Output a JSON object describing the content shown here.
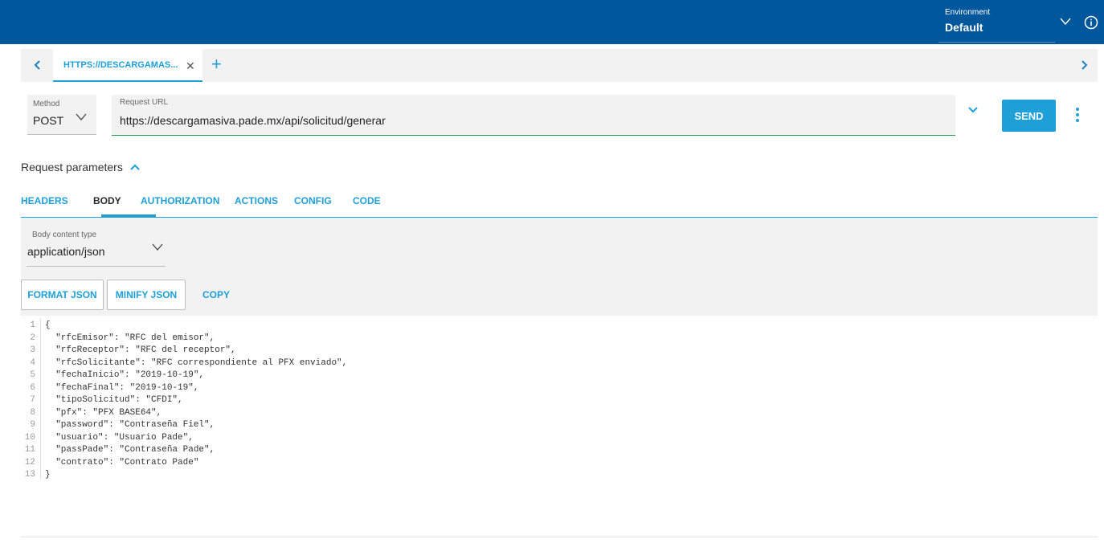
{
  "topbar": {
    "environment_label": "Environment",
    "environment_value": "Default"
  },
  "tabbar": {
    "active_tab_label": "HTTPS://DESCARGAMAS...",
    "close_glyph": "✕",
    "add_glyph": "+"
  },
  "request": {
    "method_label": "Method",
    "method_value": "POST",
    "url_label": "Request URL",
    "url_value": "https://descargamasiva.pade.mx/api/solicitud/generar",
    "send_label": "SEND"
  },
  "params": {
    "title": "Request parameters",
    "tabs": [
      "HEADERS",
      "BODY",
      "AUTHORIZATION",
      "ACTIONS",
      "CONFIG",
      "CODE"
    ],
    "active_tab": "BODY"
  },
  "body": {
    "content_type_label": "Body content type",
    "content_type_value": "application/json",
    "format_label": "FORMAT JSON",
    "minify_label": "MINIFY JSON",
    "copy_label": "COPY"
  },
  "editor": {
    "lines": [
      {
        "n": "1",
        "text": "{"
      },
      {
        "n": "2",
        "text": "  \"rfcEmisor\": \"RFC del emisor\","
      },
      {
        "n": "3",
        "text": "  \"rfcReceptor\": \"RFC del receptor\","
      },
      {
        "n": "4",
        "text": "  \"rfcSolicitante\": \"RFC correspondiente al PFX enviado\","
      },
      {
        "n": "5",
        "text": "  \"fechaInicio\": \"2019-10-19\","
      },
      {
        "n": "6",
        "text": "  \"fechaFinal\": \"2019-10-19\","
      },
      {
        "n": "7",
        "text": "  \"tipoSolicitud\": \"CFDI\","
      },
      {
        "n": "8",
        "text": "  \"pfx\": \"PFX BASE64\","
      },
      {
        "n": "9",
        "text": "  \"password\": \"Contraseña Fiel\","
      },
      {
        "n": "10",
        "text": "  \"usuario\": \"Usuario Pade\","
      },
      {
        "n": "11",
        "text": "  \"passPade\": \"Contraseña Pade\","
      },
      {
        "n": "12",
        "text": "  \"contrato\": \"Contrato Pade\""
      },
      {
        "n": "13",
        "text": "}"
      }
    ]
  },
  "colors": {
    "topbar": "#00579c",
    "accent": "#1e9fd8",
    "url_underline": "#2aa35a"
  },
  "icons": [
    "chevron-down-icon",
    "info-icon",
    "chevron-left-icon",
    "chevron-right-icon",
    "close-icon",
    "plus-icon",
    "more-vert-icon",
    "chevron-up-icon"
  ]
}
